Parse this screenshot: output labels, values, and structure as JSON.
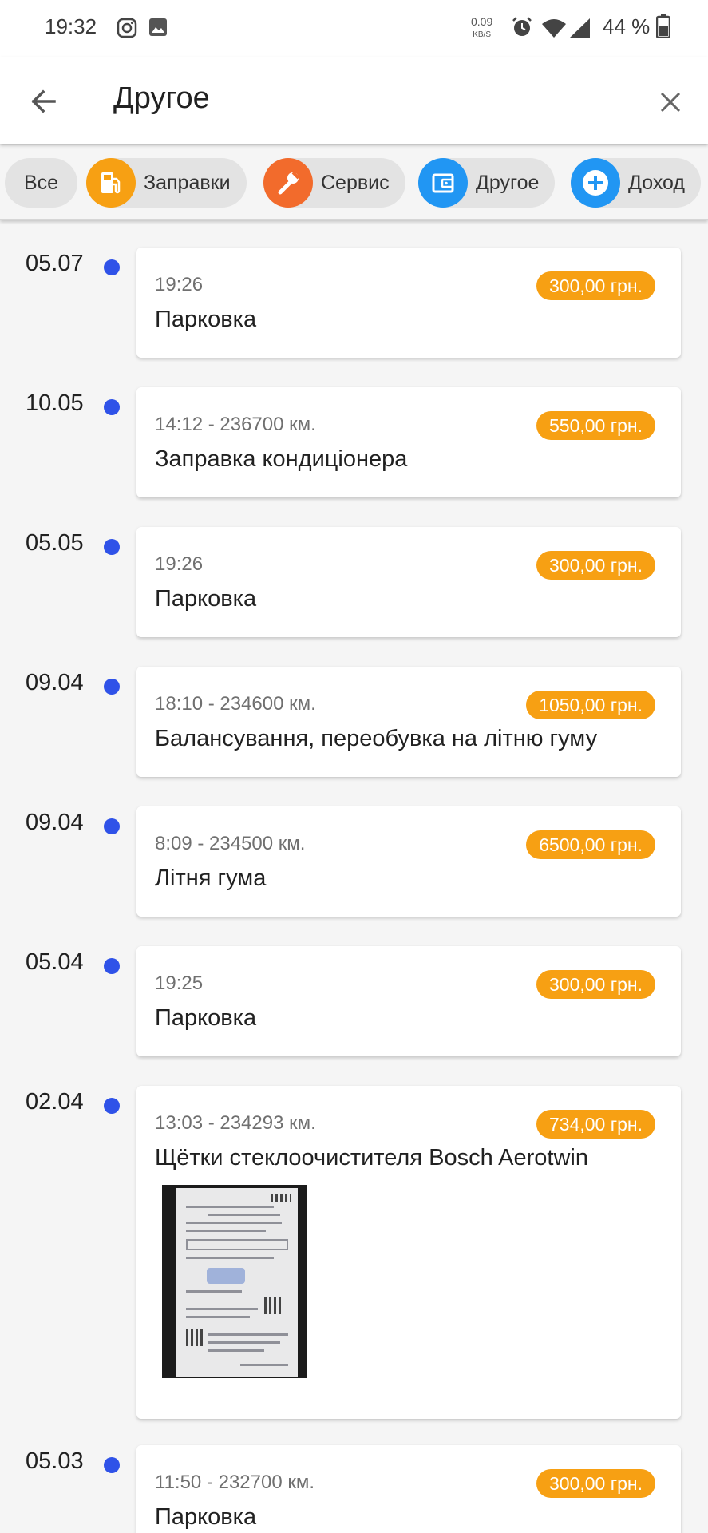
{
  "status": {
    "time": "19:32",
    "net_speed": "0.09",
    "net_unit": "KB/S",
    "battery": "44 %"
  },
  "header": {
    "title": "Другое",
    "back_icon": "arrow-left-icon",
    "close_icon": "close-icon"
  },
  "filters": [
    {
      "label": "Все",
      "icon": "",
      "color": ""
    },
    {
      "label": "Заправки",
      "icon": "fuel-pump-icon",
      "color": "#f7a013"
    },
    {
      "label": "Сервис",
      "icon": "wrench-icon",
      "color": "#f26b2c"
    },
    {
      "label": "Другое",
      "icon": "wallet-icon",
      "color": "#2196f3"
    },
    {
      "label": "Доход",
      "icon": "plus-icon",
      "color": "#2196f3"
    }
  ],
  "colors": {
    "accent_orange": "#f7a013",
    "dot_blue": "#2f52e8",
    "card_bg": "#ffffff"
  },
  "entries": [
    {
      "date": "05.07",
      "meta": "19:26",
      "price": "300,00 грн.",
      "name": "Парковка",
      "has_photo": false
    },
    {
      "date": "10.05",
      "meta": "14:12 - 236700 км.",
      "price": "550,00 грн.",
      "name": "Заправка кондиціонера",
      "has_photo": false
    },
    {
      "date": "05.05",
      "meta": "19:26",
      "price": "300,00 грн.",
      "name": "Парковка",
      "has_photo": false
    },
    {
      "date": "09.04",
      "meta": "18:10 - 234600 км.",
      "price": "1050,00 грн.",
      "name": "Балансування, переобувка на літню гуму",
      "has_photo": false
    },
    {
      "date": "09.04",
      "meta": "8:09 - 234500 км.",
      "price": "6500,00 грн.",
      "name": "Літня гума",
      "has_photo": false
    },
    {
      "date": "05.04",
      "meta": "19:25",
      "price": "300,00 грн.",
      "name": "Парковка",
      "has_photo": false
    },
    {
      "date": "02.04",
      "meta": "13:03 - 234293 км.",
      "price": "734,00 грн.",
      "name": "Щётки стеклоочистителя Bosch Aerotwin",
      "has_photo": true
    },
    {
      "date": "05.03",
      "meta": "11:50 - 232700 км.",
      "price": "300,00 грн.",
      "name": "Парковка",
      "has_photo": false
    }
  ]
}
